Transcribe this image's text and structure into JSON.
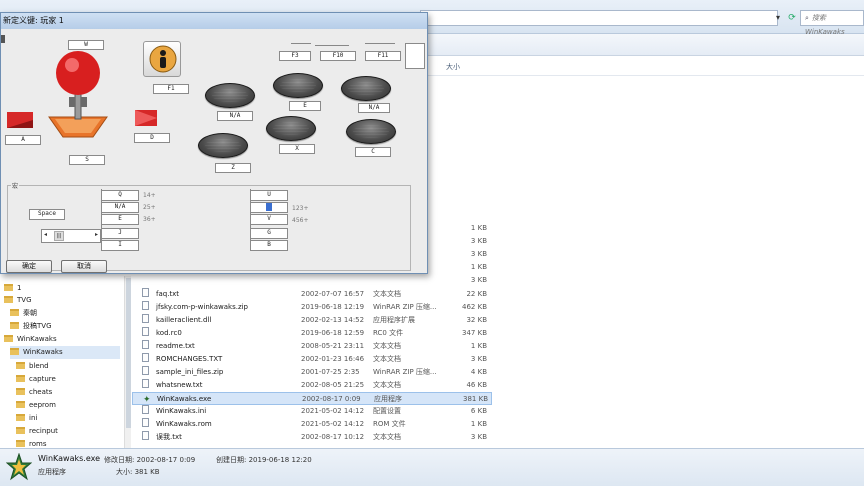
{
  "explorer": {
    "search_placeholder": "搜索 WinKawaks",
    "size_column": "大小",
    "tree": [
      {
        "label": "1"
      },
      {
        "label": "TVG"
      },
      {
        "label": "秦朝"
      },
      {
        "label": "投稿TVG"
      },
      {
        "label": "WinKawaks"
      },
      {
        "label": "WinKawaks"
      },
      {
        "label": "blend"
      },
      {
        "label": "capture"
      },
      {
        "label": "cheats"
      },
      {
        "label": "eeprom"
      },
      {
        "label": "ini"
      },
      {
        "label": "recinput"
      },
      {
        "label": "roms"
      }
    ],
    "partial_sizes": [
      "1 KB",
      "3 KB",
      "3 KB",
      "1 KB",
      "3 KB"
    ],
    "files": [
      {
        "name": "faq.txt",
        "date": "2002-07-07 16:57",
        "type": "文本文档",
        "size": "22 KB"
      },
      {
        "name": "jfsky.com-p-winkawaks.zip",
        "date": "2019-06-18 12:19",
        "type": "WinRAR ZIP 压缩...",
        "size": "462 KB"
      },
      {
        "name": "kailleraclient.dll",
        "date": "2002-02-13 14:52",
        "type": "应用程序扩展",
        "size": "32 KB"
      },
      {
        "name": "kod.rc0",
        "date": "2019-06-18 12:59",
        "type": "RC0 文件",
        "size": "347 KB"
      },
      {
        "name": "readme.txt",
        "date": "2008-05-21 23:11",
        "type": "文本文档",
        "size": "1 KB"
      },
      {
        "name": "ROMCHANGES.TXT",
        "date": "2002-01-23 16:46",
        "type": "文本文档",
        "size": "3 KB"
      },
      {
        "name": "sample_ini_files.zip",
        "date": "2001-07-25 2:35",
        "type": "WinRAR ZIP 压缩...",
        "size": "4 KB"
      },
      {
        "name": "whatsnew.txt",
        "date": "2002-08-05 21:25",
        "type": "文本文档",
        "size": "46 KB"
      },
      {
        "name": "WinKawaks.exe",
        "date": "2002-08-17 0:09",
        "type": "应用程序",
        "size": "381 KB"
      },
      {
        "name": "WinKawaks.ini",
        "date": "2021-05-02 14:12",
        "type": "配置设置",
        "size": "6 KB"
      },
      {
        "name": "WinKawaks.rom",
        "date": "2021-05-02 14:12",
        "type": "ROM 文件",
        "size": "1 KB"
      },
      {
        "name": "误我.txt",
        "date": "2002-08-17 10:12",
        "type": "文本文档",
        "size": "3 KB"
      }
    ],
    "status": {
      "filename": "WinKawaks.exe",
      "modified_label": "修改日期: 2002-08-17 0:09",
      "created_label": "创建日期: 2019-06-18 12:20",
      "type": "应用程序",
      "size_label": "大小: 381 KB"
    }
  },
  "dialog": {
    "title": "新定义键: 玩家 1",
    "keys": {
      "up": "W",
      "down": "S",
      "left": "A",
      "right": "D",
      "start": "F1",
      "f3": "F3",
      "f10": "F10",
      "f11": "F11",
      "btn1": "N/A",
      "btn2": "E",
      "btn3": "N/A",
      "btn4": "Z",
      "btn5": "X",
      "btn6": "C"
    },
    "group_label": "宏",
    "space_label": "Space",
    "macro_left": [
      "Q",
      "N/A",
      "E",
      "J",
      "I"
    ],
    "macro_left_vals": [
      "14+",
      "25+",
      "36+"
    ],
    "macro_right": [
      "U",
      "",
      "V",
      "G",
      "B"
    ],
    "macro_right_vals": [
      "123+",
      "456+"
    ],
    "ok_label": "确定",
    "cancel_label": "取消"
  }
}
